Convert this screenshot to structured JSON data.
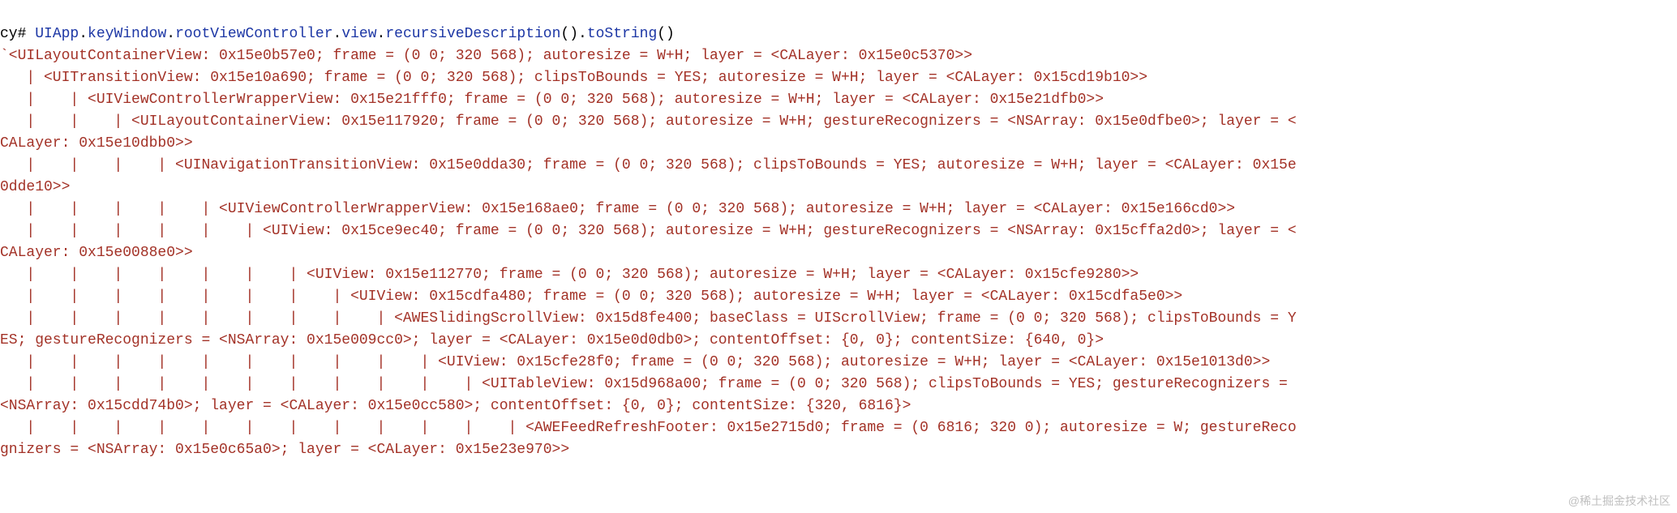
{
  "cmd": {
    "prompt": "cy# ",
    "parts": [
      {
        "t": "UIApp",
        "c": "k"
      },
      {
        "t": ".",
        "c": "p"
      },
      {
        "t": "keyWindow",
        "c": "k"
      },
      {
        "t": ".",
        "c": "p"
      },
      {
        "t": "rootViewController",
        "c": "k"
      },
      {
        "t": ".",
        "c": "p"
      },
      {
        "t": "view",
        "c": "k"
      },
      {
        "t": ".",
        "c": "p"
      },
      {
        "t": "recursiveDescription",
        "c": "k"
      },
      {
        "t": "()",
        "c": "par"
      },
      {
        "t": ".",
        "c": "p"
      },
      {
        "t": "toString",
        "c": "k"
      },
      {
        "t": "()",
        "c": "par"
      }
    ]
  },
  "output_lines": [
    "`<UILayoutContainerView: 0x15e0b57e0; frame = (0 0; 320 568); autoresize = W+H; layer = <CALayer: 0x15e0c5370>>",
    "   | <UITransitionView: 0x15e10a690; frame = (0 0; 320 568); clipsToBounds = YES; autoresize = W+H; layer = <CALayer: 0x15cd19b10>>",
    "   |    | <UIViewControllerWrapperView: 0x15e21fff0; frame = (0 0; 320 568); autoresize = W+H; layer = <CALayer: 0x15e21dfb0>>",
    "   |    |    | <UILayoutContainerView: 0x15e117920; frame = (0 0; 320 568); autoresize = W+H; gestureRecognizers = <NSArray: 0x15e0dfbe0>; layer = <",
    "CALayer: 0x15e10dbb0>>",
    "   |    |    |    | <UINavigationTransitionView: 0x15e0dda30; frame = (0 0; 320 568); clipsToBounds = YES; autoresize = W+H; layer = <CALayer: 0x15e",
    "0dde10>>",
    "   |    |    |    |    | <UIViewControllerWrapperView: 0x15e168ae0; frame = (0 0; 320 568); autoresize = W+H; layer = <CALayer: 0x15e166cd0>>",
    "   |    |    |    |    |    | <UIView: 0x15ce9ec40; frame = (0 0; 320 568); autoresize = W+H; gestureRecognizers = <NSArray: 0x15cffa2d0>; layer = <",
    "CALayer: 0x15e0088e0>>",
    "   |    |    |    |    |    |    | <UIView: 0x15e112770; frame = (0 0; 320 568); autoresize = W+H; layer = <CALayer: 0x15cfe9280>>",
    "   |    |    |    |    |    |    |    | <UIView: 0x15cdfa480; frame = (0 0; 320 568); autoresize = W+H; layer = <CALayer: 0x15cdfa5e0>>",
    "   |    |    |    |    |    |    |    |    | <AWESlidingScrollView: 0x15d8fe400; baseClass = UIScrollView; frame = (0 0; 320 568); clipsToBounds = Y",
    "ES; gestureRecognizers = <NSArray: 0x15e009cc0>; layer = <CALayer: 0x15e0d0db0>; contentOffset: {0, 0}; contentSize: {640, 0}>",
    "   |    |    |    |    |    |    |    |    |    | <UIView: 0x15cfe28f0; frame = (0 0; 320 568); autoresize = W+H; layer = <CALayer: 0x15e1013d0>>",
    "   |    |    |    |    |    |    |    |    |    |    | <UITableView: 0x15d968a00; frame = (0 0; 320 568); clipsToBounds = YES; gestureRecognizers = ",
    "<NSArray: 0x15cdd74b0>; layer = <CALayer: 0x15e0cc580>; contentOffset: {0, 0}; contentSize: {320, 6816}>",
    "   |    |    |    |    |    |    |    |    |    |    |    | <AWEFeedRefreshFooter: 0x15e2715d0; frame = (0 6816; 320 0); autoresize = W; gestureReco",
    "gnizers = <NSArray: 0x15e0c65a0>; layer = <CALayer: 0x15e23e970>>"
  ],
  "watermark": "@稀土掘金技术社区"
}
